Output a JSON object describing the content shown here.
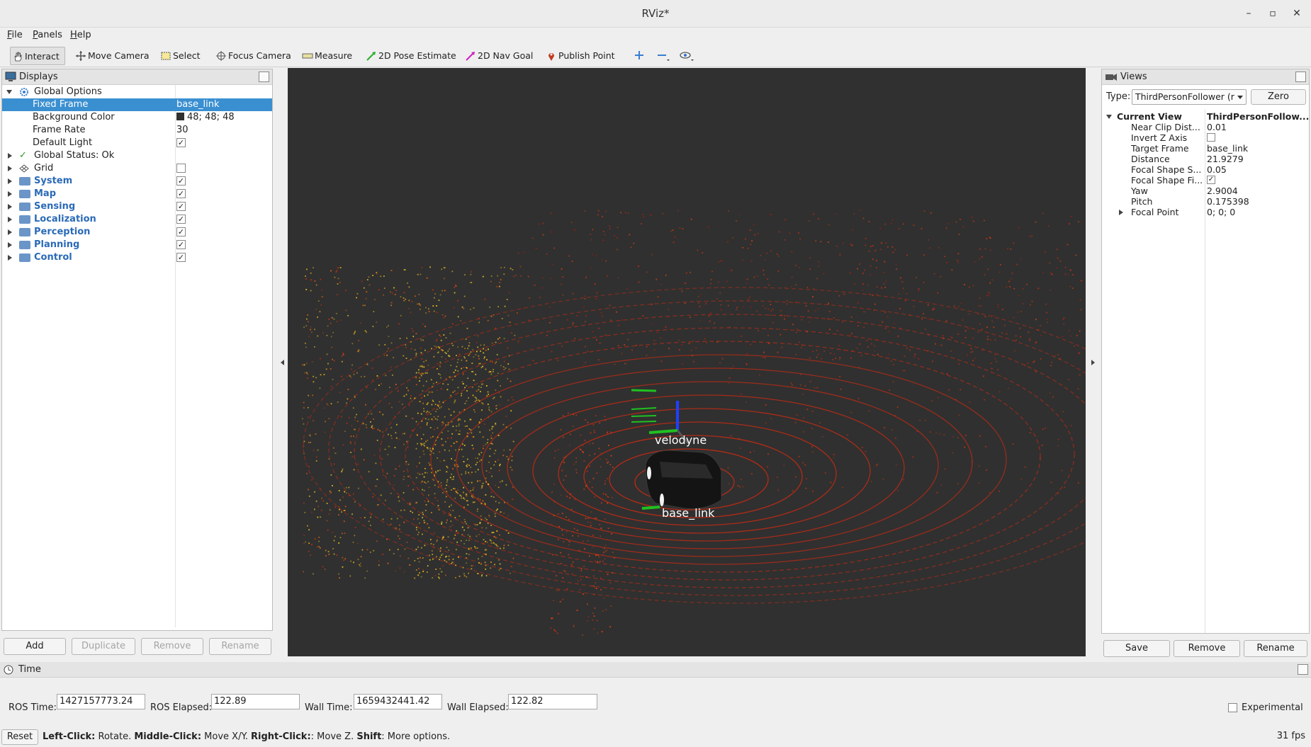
{
  "window": {
    "title": "RViz*",
    "minimize": "–",
    "maximize": "▫",
    "close": "✕"
  },
  "menu": {
    "file": "File",
    "file_mnemonic": "F",
    "file_rest": "ile",
    "panels": "Panels",
    "panels_mnemonic": "P",
    "panels_rest": "anels",
    "help": "Help",
    "help_mnemonic": "H",
    "help_rest": "elp"
  },
  "toolbar": {
    "interact": "Interact",
    "move_camera": "Move Camera",
    "select": "Select",
    "focus_camera": "Focus Camera",
    "measure": "Measure",
    "pose_estimate": "2D Pose Estimate",
    "nav_goal": "2D Nav Goal",
    "publish_point": "Publish Point"
  },
  "displays": {
    "title": "Displays",
    "global_options": "Global Options",
    "fixed_frame_label": "Fixed Frame",
    "fixed_frame_value": "base_link",
    "bg_color_label": "Background Color",
    "bg_color_value": "48; 48; 48",
    "bg_color_hex": "#303030",
    "frame_rate_label": "Frame Rate",
    "frame_rate_value": "30",
    "default_light_label": "Default Light",
    "default_light_checked": true,
    "global_status": "Global Status: Ok",
    "grid": "Grid",
    "grid_checked": false,
    "groups": [
      {
        "label": "System",
        "checked": true
      },
      {
        "label": "Map",
        "checked": true
      },
      {
        "label": "Sensing",
        "checked": true
      },
      {
        "label": "Localization",
        "checked": true
      },
      {
        "label": "Perception",
        "checked": true
      },
      {
        "label": "Planning",
        "checked": true
      },
      {
        "label": "Control",
        "checked": true
      }
    ],
    "buttons": {
      "add": "Add",
      "duplicate": "Duplicate",
      "remove": "Remove",
      "rename": "Rename"
    }
  },
  "viewport": {
    "labels": {
      "velodyne": "velodyne",
      "base_link": "base_link"
    },
    "colors": {
      "ring": "#d42a10",
      "near": "#e8c020",
      "far": "#c03010",
      "axis_x": "#e0e0e0",
      "axis_y": "#20c020",
      "axis_z": "#2040ff"
    }
  },
  "views": {
    "title": "Views",
    "type_label": "Type:",
    "type_value": "ThirdPersonFollower (r",
    "zero": "Zero",
    "current_view_label": "Current View",
    "current_view_value": "ThirdPersonFollow...",
    "props": [
      {
        "label": "Near Clip Dist...",
        "value": "0.01"
      },
      {
        "label": "Invert Z Axis",
        "value": "",
        "checkbox": false
      },
      {
        "label": "Target Frame",
        "value": "base_link"
      },
      {
        "label": "Distance",
        "value": "21.9279"
      },
      {
        "label": "Focal Shape S...",
        "value": "0.05"
      },
      {
        "label": "Focal Shape Fi...",
        "value": "",
        "checkbox": true
      },
      {
        "label": "Yaw",
        "value": "2.9004"
      },
      {
        "label": "Pitch",
        "value": "0.175398"
      },
      {
        "label": "Focal Point",
        "value": "0; 0; 0"
      }
    ],
    "buttons": {
      "save": "Save",
      "remove": "Remove",
      "rename": "Rename"
    }
  },
  "time": {
    "title": "Time",
    "ros_time_label": "ROS Time:",
    "ros_time": "1427157773.24",
    "ros_elapsed_label": "ROS Elapsed:",
    "ros_elapsed": "122.89",
    "wall_time_label": "Wall Time:",
    "wall_time": "1659432441.42",
    "wall_elapsed_label": "Wall Elapsed:",
    "wall_elapsed": "122.82",
    "experimental": "Experimental"
  },
  "status": {
    "reset": "Reset",
    "left_click": "Left-Click:",
    "left_click_desc": " Rotate. ",
    "middle_click": "Middle-Click:",
    "middle_click_desc": " Move X/Y. ",
    "right_click": "Right-Click:",
    "right_click_desc": ": Move Z. ",
    "shift": "Shift",
    "shift_desc": ": More options.",
    "fps": "31 fps"
  }
}
